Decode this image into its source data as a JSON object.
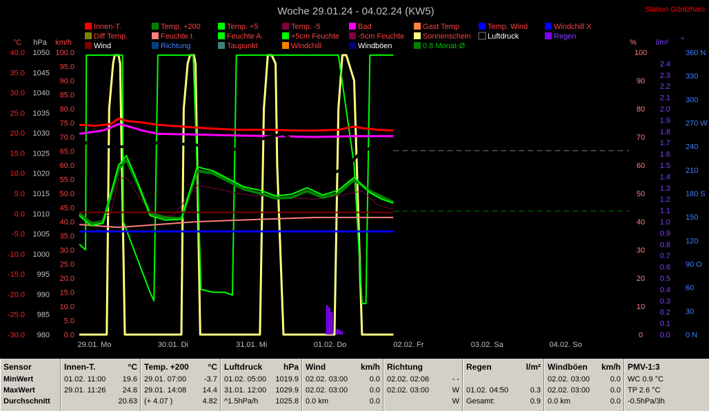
{
  "title": "Woche 29.01.24 - 04.02.24 (KW5)",
  "station": "Station Göritzhain",
  "legend": [
    {
      "label": "Innen-T.",
      "color": "#ff0000"
    },
    {
      "label": "Temp. +200",
      "color": "#008000"
    },
    {
      "label": "Temp. +5",
      "color": "#00ff00"
    },
    {
      "label": "Temp. -5",
      "color": "#800040"
    },
    {
      "label": "Bad",
      "color": "#ff00ff"
    },
    {
      "label": "Gast Temp",
      "color": "#ff8040"
    },
    {
      "label": "Temp. Wind",
      "color": "#0000ff"
    },
    {
      "label": "Windchill X",
      "color": "#0000ff"
    },
    {
      "label": "Diff Temp.",
      "color": "#808000"
    },
    {
      "label": "Feuchte I.",
      "color": "#ff8080"
    },
    {
      "label": "Feuchte A.",
      "color": "#00ff00"
    },
    {
      "label": "+5cm Feuchte",
      "color": "#00ff00"
    },
    {
      "label": "-5cm Feuchte",
      "color": "#800040"
    },
    {
      "label": "Sonnenschein",
      "color": "#ffff80"
    },
    {
      "label": "Luftdruck",
      "color": "#000000"
    },
    {
      "label": "Regen",
      "color": "#8000ff"
    },
    {
      "label": "Wind",
      "color": "#800000"
    },
    {
      "label": "Richtung",
      "color": "#004080"
    },
    {
      "label": "Taupunkt",
      "color": "#408080"
    },
    {
      "label": "Windchill",
      "color": "#ff8000"
    },
    {
      "label": "Windböen",
      "color": "#000080"
    },
    {
      "label": "0.8 Monat-Ø",
      "color": "#008000"
    }
  ],
  "axis_headers": {
    "temp": "°C",
    "pressure": "hPa",
    "speed": "km/h",
    "humidity": "%",
    "rain": "l/m²",
    "direction": "°"
  },
  "chart_data": {
    "type": "line",
    "title": "Woche 29.01.24 - 04.02.24 (KW5)",
    "x_ticks": [
      "29.01. Mo",
      "30.01. Di",
      "31.01. Mi",
      "01.02. Do",
      "02.02. Fr",
      "03.02. Sa",
      "04.02. So"
    ],
    "axes": {
      "temp": {
        "min": -30,
        "max": 40,
        "ticks": [
          "40.0",
          "35.0",
          "30.0",
          "25.0",
          "20.0",
          "15.0",
          "10.0",
          "5.0",
          "0.0",
          "-5.0",
          "-10.0",
          "-15.0",
          "-20.0",
          "-25.0",
          "-30.0"
        ]
      },
      "pressure": {
        "min": 980,
        "max": 1050,
        "ticks": [
          "1050",
          "1045",
          "1040",
          "1035",
          "1030",
          "1025",
          "1020",
          "1015",
          "1010",
          "1005",
          "1000",
          "995",
          "990",
          "985",
          "980"
        ]
      },
      "speed": {
        "min": 0,
        "max": 100,
        "ticks": [
          "100.0",
          "95.0",
          "90.0",
          "85.0",
          "80.0",
          "75.0",
          "70.0",
          "65.0",
          "60.0",
          "55.0",
          "50.0",
          "45.0",
          "40.0",
          "35.0",
          "30.0",
          "25.0",
          "20.0",
          "15.0",
          "10.0",
          "5.0",
          "0.0"
        ]
      },
      "humidity": {
        "min": 0,
        "max": 100,
        "ticks": [
          "100",
          "90",
          "80",
          "70",
          "60",
          "50",
          "40",
          "30",
          "20",
          "10",
          "0"
        ]
      },
      "rain": {
        "min": 0,
        "max": 2.5,
        "ticks": [
          "2.4",
          "2.3",
          "2.2",
          "2.1",
          "2.0",
          "1.9",
          "1.8",
          "1.7",
          "1.6",
          "1.5",
          "1.4",
          "1.3",
          "1.2",
          "1.1",
          "1.0",
          "0.9",
          "0.8",
          "0.7",
          "0.6",
          "0.5",
          "0.4",
          "0.3",
          "0.2",
          "0.1",
          "0.0"
        ]
      },
      "direction": {
        "min": 0,
        "max": 360,
        "ticks": [
          "360 N",
          "330",
          "300",
          "270 W",
          "240",
          "210",
          "180 S",
          "150",
          "120",
          "90 O",
          "60",
          "30",
          "0 N"
        ]
      }
    },
    "reference_lines": {
      "pressure_month_avg": 1025.6,
      "temp_zero": 0.0,
      "temp_dash_green": 0.6
    },
    "series": [
      {
        "name": "Innen-T.",
        "axis": "temp",
        "color": "#ff0000",
        "width": 3,
        "x": [
          0,
          0.2,
          0.4,
          0.5,
          0.6,
          0.8,
          1.0,
          1.3,
          1.6,
          2.0,
          2.4,
          2.8,
          3.0,
          3.3,
          3.5,
          3.6,
          3.8,
          4.0
        ],
        "y": [
          22.0,
          21.8,
          22.2,
          23.6,
          23.0,
          22.6,
          22.0,
          21.6,
          21.2,
          20.8,
          20.8,
          20.6,
          20.6,
          20.8,
          21.6,
          21.2,
          20.8,
          20.6
        ]
      },
      {
        "name": "Bad",
        "axis": "temp",
        "color": "#ff00ff",
        "width": 3,
        "x": [
          0,
          0.3,
          0.5,
          0.6,
          0.8,
          1.0,
          1.5,
          2.0,
          2.5,
          3.0,
          3.5,
          4.0
        ],
        "y": [
          19.8,
          20.6,
          22.2,
          21.8,
          20.6,
          19.8,
          19.6,
          19.4,
          19.2,
          19.0,
          19.2,
          19.2
        ]
      },
      {
        "name": "Luftdruck",
        "axis": "pressure",
        "color": "#000000",
        "width": 4,
        "x": [
          0,
          0.2,
          0.5,
          0.8,
          1.0,
          1.2,
          1.5,
          1.8,
          2.0,
          2.2,
          2.4,
          2.6,
          2.8,
          3.0,
          3.2,
          3.4,
          3.6,
          3.8,
          4.0
        ],
        "y": [
          1028.2,
          1026.6,
          1026.6,
          1026.6,
          1027.6,
          1027.4,
          1027.0,
          1025.6,
          1026.0,
          1027.6,
          1029.0,
          1029.8,
          1027.0,
          1021.0,
          1019.8,
          1021.4,
          1025.6,
          1026.6,
          1026.2
        ]
      },
      {
        "name": "Temp. +200",
        "axis": "temp",
        "color": "#008000",
        "width": 4,
        "x": [
          0,
          0.15,
          0.3,
          0.5,
          0.6,
          0.75,
          0.9,
          1.1,
          1.3,
          1.5,
          1.7,
          1.9,
          2.1,
          2.3,
          2.5,
          2.7,
          2.9,
          3.1,
          3.3,
          3.5,
          3.7,
          3.85,
          4.0
        ],
        "y": [
          0,
          -2.4,
          -2.0,
          11.0,
          13.4,
          7.0,
          0,
          -1.0,
          -1.2,
          10.6,
          10.0,
          8.0,
          6.0,
          5.0,
          3.8,
          4.0,
          5.6,
          4.0,
          5.0,
          8.4,
          5.6,
          4.2,
          2.8
        ]
      },
      {
        "name": "Temp. +5",
        "axis": "temp",
        "color": "#00ff00",
        "width": 2,
        "x": [
          0,
          0.15,
          0.3,
          0.5,
          0.6,
          0.75,
          0.9,
          1.1,
          1.3,
          1.5,
          1.7,
          1.9,
          2.1,
          2.3,
          2.5,
          2.7,
          2.9,
          3.1,
          3.3,
          3.5,
          3.7,
          3.85,
          4.0
        ],
        "y": [
          -0.5,
          -3.0,
          -2.4,
          12.0,
          14.4,
          7.4,
          -0.5,
          -1.6,
          -1.4,
          11.6,
          10.6,
          8.6,
          6.6,
          5.8,
          4.4,
          4.8,
          6.4,
          4.6,
          5.8,
          9.0,
          5.2,
          3.6,
          2.6
        ]
      },
      {
        "name": "Temp. -5",
        "axis": "temp",
        "color": "#800040",
        "width": 1,
        "x": [
          0,
          0.2,
          0.4,
          0.5,
          0.6,
          0.8,
          1.0,
          1.2,
          1.5,
          1.8,
          2.0,
          2.3,
          2.6,
          3.0,
          3.3,
          3.6,
          3.8,
          4.0
        ],
        "y": [
          0,
          -2.6,
          0,
          8.6,
          9.0,
          3.0,
          -0.8,
          -0.4,
          7.0,
          6.0,
          5.0,
          4.4,
          4.0,
          3.6,
          4.4,
          5.6,
          2.2,
          1.0
        ]
      },
      {
        "name": "Feuchte I.",
        "axis": "humidity",
        "color": "#ff8080",
        "width": 2,
        "x": [
          0,
          0.5,
          1.0,
          1.5,
          2.0,
          2.5,
          3.0,
          3.5,
          4.0
        ],
        "y": [
          39,
          38,
          39,
          40,
          40.5,
          41,
          41.5,
          41.5,
          41.5
        ]
      },
      {
        "name": "Windböen",
        "axis": "temp",
        "color": "#0000ff",
        "width": 3,
        "x": [
          0,
          4.0
        ],
        "y": [
          -4.4,
          -4.4
        ]
      },
      {
        "name": "Wind",
        "axis": "temp",
        "color": "#800000",
        "width": 2,
        "x": [
          0,
          4.0
        ],
        "y": [
          0.3,
          0.3
        ]
      },
      {
        "name": "Feuchte A.",
        "axis": "humidity",
        "color": "#00ff00",
        "width": 2,
        "x": [
          0,
          0.08,
          0.09,
          0.55,
          0.56,
          0.9,
          0.95,
          1.0,
          1.05,
          1.45,
          1.5,
          1.55,
          1.7,
          1.8,
          1.85,
          1.95,
          2.0,
          2.4,
          2.45,
          2.6,
          2.85,
          3.1,
          3.3,
          3.5,
          3.6,
          3.65,
          3.7,
          3.8,
          3.9,
          4.0
        ],
        "y": [
          32,
          30,
          99,
          99,
          40,
          15,
          12,
          99,
          99,
          99,
          60,
          16,
          15,
          15,
          15,
          14,
          99,
          99,
          99,
          99,
          99,
          99,
          99,
          60,
          11,
          11,
          99,
          99,
          99,
          99
        ]
      },
      {
        "name": "Sonnenschein",
        "axis": "humidity",
        "color": "#ffff80",
        "width": 3,
        "x": [
          0,
          0.35,
          0.38,
          0.43,
          0.45,
          0.5,
          0.52,
          0.58,
          1.3,
          1.33,
          1.38,
          1.41,
          1.46,
          1.48,
          1.54,
          2.3,
          2.35,
          2.4,
          2.45,
          2.5,
          2.52,
          2.6,
          3.25,
          3.3,
          3.35,
          3.4,
          3.5,
          3.6,
          3.63,
          4.0
        ],
        "y": [
          0,
          0,
          80,
          96,
          99,
          99,
          96,
          0,
          0,
          80,
          96,
          99,
          99,
          96,
          0,
          0,
          80,
          99,
          99,
          96,
          60,
          0,
          0,
          80,
          99,
          99,
          90,
          0,
          0,
          0
        ]
      },
      {
        "name": "Regen",
        "axis": "rain",
        "color": "#8000ff",
        "type": "bar",
        "x": [
          3.15,
          3.18,
          3.21,
          3.28,
          3.31,
          3.34
        ],
        "y": [
          0.26,
          0.24,
          0.2,
          0.05,
          0.04,
          0.03
        ]
      }
    ]
  },
  "stats": {
    "row_labels": [
      "Sensor",
      "MinWert",
      "MaxWert",
      "Durchschnitt"
    ],
    "innen": {
      "title": "Innen-T.",
      "unit": "°C",
      "rows": [
        [
          "01.02. 11:00",
          "19.6"
        ],
        [
          "29.01. 11:26",
          "24.8"
        ],
        [
          "",
          "20.63"
        ]
      ]
    },
    "temp200": {
      "title": "Temp. +200",
      "unit": "°C",
      "rows": [
        [
          "29.01. 07:00",
          "-3.7"
        ],
        [
          "29.01. 14:08",
          "14.4"
        ],
        [
          "(+ 4.07 )",
          "4.82"
        ]
      ]
    },
    "druck": {
      "title": "Luftdruck",
      "unit": "hPa",
      "rows": [
        [
          "01.02. 05:00",
          "1019.9"
        ],
        [
          "31.01. 12:00",
          "1029.9"
        ],
        [
          "^1.5hPa/h",
          "1025.8"
        ]
      ]
    },
    "wind": {
      "title": "Wind",
      "unit": "km/h",
      "rows": [
        [
          "02.02. 03:00",
          "0.0"
        ],
        [
          "02.02. 03:00",
          "0.0"
        ],
        [
          "0.0 km",
          "0.0"
        ]
      ]
    },
    "richtung": {
      "title": "Richtung",
      "unit": "",
      "rows": [
        [
          "02.02. 02:06",
          "- -"
        ],
        [
          "02.02. 03:00",
          "W"
        ],
        [
          "",
          "W"
        ]
      ]
    },
    "regen": {
      "title": "Regen",
      "unit": "l/m²",
      "rows": [
        [
          "",
          ""
        ],
        [
          "01.02. 04:50",
          "0.3"
        ],
        [
          "Gesamt:",
          "0.9"
        ]
      ]
    },
    "boeen": {
      "title": "Windböen",
      "unit": "km/h",
      "rows": [
        [
          "02.02. 03:00",
          "0.0"
        ],
        [
          "02.02. 03:00",
          "0.0"
        ],
        [
          "0.0 km",
          "0.0"
        ]
      ]
    },
    "pmv": {
      "title": "PMV-1:3",
      "rows": [
        "WC 0.9 °C",
        "TP 2.6 °C",
        "-0.5hPa/3h"
      ]
    }
  }
}
